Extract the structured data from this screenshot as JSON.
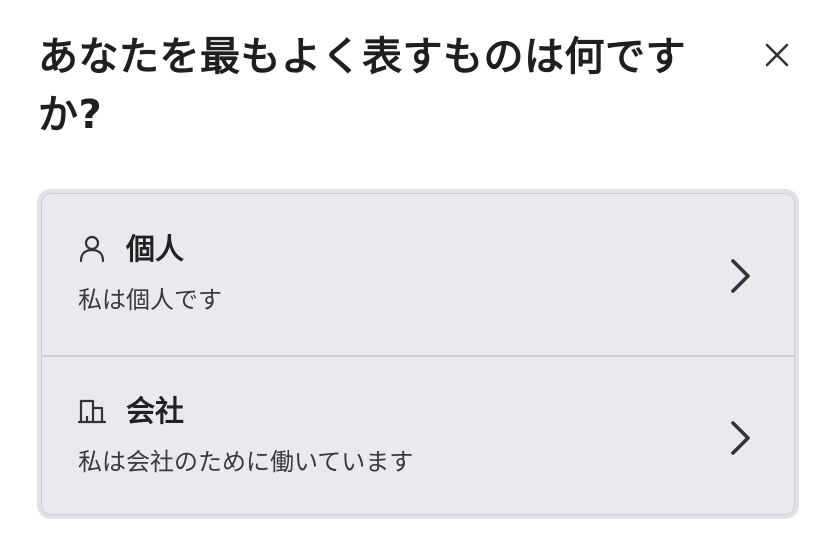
{
  "dialog": {
    "title": "あなたを最もよく表すものは何ですか?",
    "close_icon": "close-icon"
  },
  "options": [
    {
      "icon": "person-icon",
      "title": "個人",
      "description": "私は個人です",
      "chevron_icon": "chevron-right-icon"
    },
    {
      "icon": "building-icon",
      "title": "会社",
      "description": "私は会社のために働いています",
      "chevron_icon": "chevron-right-icon"
    }
  ],
  "colors": {
    "card_background": "#ebe9ef",
    "card_border": "#cfcdd4",
    "text_primary": "#222222"
  }
}
